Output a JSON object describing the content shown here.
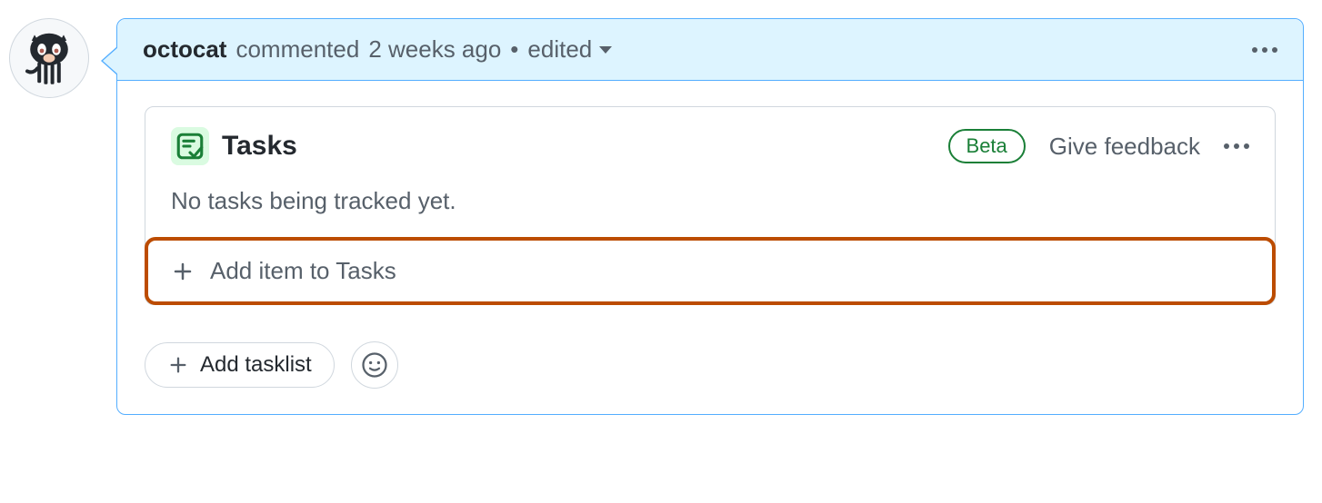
{
  "comment": {
    "username": "octocat",
    "action_text": "commented",
    "timestamp": "2 weeks ago",
    "separator": "•",
    "edited_label": "edited"
  },
  "tasks": {
    "title": "Tasks",
    "badge": "Beta",
    "feedback_label": "Give feedback",
    "empty_text": "No tasks being tracked yet.",
    "add_item_label": "Add item to Tasks"
  },
  "footer": {
    "add_tasklist_label": "Add tasklist"
  }
}
